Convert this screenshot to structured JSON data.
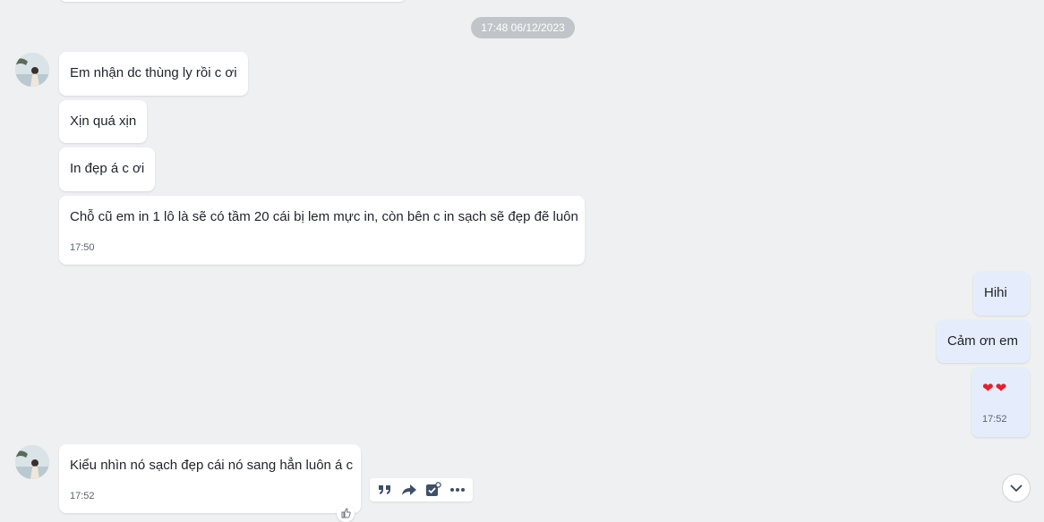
{
  "date_separator": "17:48 06/12/2023",
  "incoming_group_1": {
    "messages": [
      {
        "text": "Em nhận dc thùng ly rồi c ơi"
      },
      {
        "text": "Xịn quá xịn"
      },
      {
        "text": "In đẹp á c ơi"
      },
      {
        "text": "Chỗ cũ em in 1 lô là sẽ có tầm 20 cái bị lem mực in, còn bên c in sạch sẽ đẹp đẽ luôn",
        "time": "17:50"
      }
    ]
  },
  "outgoing_group": {
    "messages": [
      {
        "text": "Hihi"
      },
      {
        "text": "Cảm ơn em"
      },
      {
        "text": "❤❤",
        "time": "17:52"
      }
    ]
  },
  "incoming_group_2": {
    "messages": [
      {
        "text": "Kiểu nhìn nó sạch đẹp cái nó sang hẳn luôn á c",
        "time": "17:52"
      }
    ]
  },
  "message_actions": [
    "quote-icon",
    "forward-icon",
    "task-icon",
    "more-icon"
  ],
  "colors": {
    "background": "#eef0f1",
    "incoming_bubble": "#ffffff",
    "outgoing_bubble": "#e5edfd",
    "heart": "#e5202e",
    "action_icon": "#3d4f6b"
  }
}
